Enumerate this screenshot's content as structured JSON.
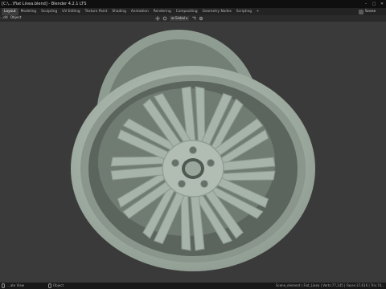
{
  "window": {
    "title": "[C:\\...\\Fiat Linea.blend] - Blender 4.2.1 LTS",
    "controls": [
      "minimize",
      "maximize",
      "close"
    ]
  },
  "workspaces": {
    "tabs": [
      "Layout",
      "Modeling",
      "Sculpting",
      "UV Editing",
      "Texture Paint",
      "Shading",
      "Animation",
      "Rendering",
      "Compositing",
      "Geometry Nodes",
      "Scripting",
      "+"
    ],
    "active": "Layout"
  },
  "scene": {
    "name": "Scene"
  },
  "header": {
    "menu": [
      "...dd",
      "Object"
    ],
    "orientation": "Global"
  },
  "viewport": {
    "background": "#3a3a3a",
    "model": "alloy-wheel",
    "model_color": "#a9b6aa"
  },
  "statusbar": {
    "left": [
      "...ate View"
    ],
    "middle": "Object",
    "right": "Scene_element | Fiat_Linea | Verts:77,145 | Faces:37,616 | Tris:74..."
  }
}
